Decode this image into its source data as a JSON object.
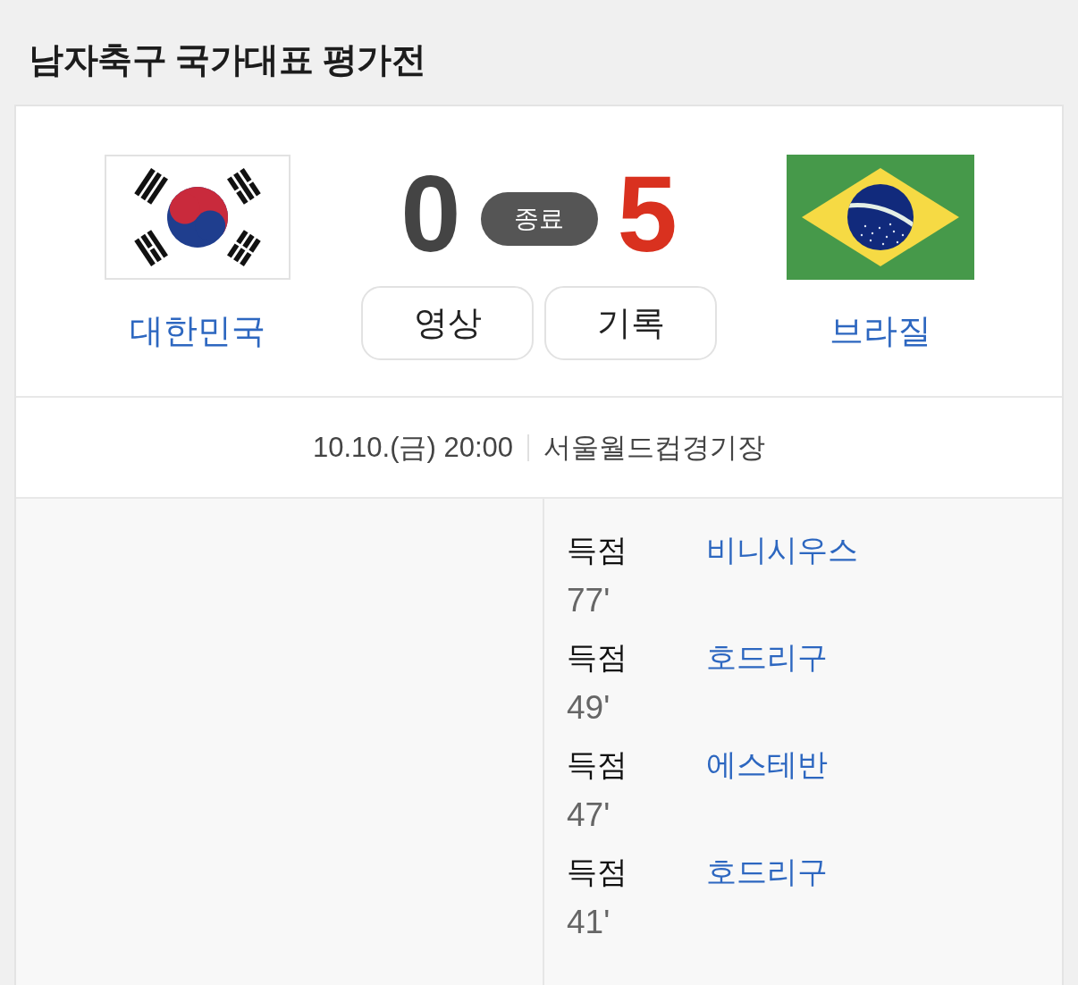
{
  "title": "남자축구 국가대표 평가전",
  "match": {
    "home": {
      "name": "대한민국",
      "score": "0",
      "winner": false
    },
    "away": {
      "name": "브라질",
      "score": "5",
      "winner": true
    },
    "status": "종료",
    "buttons": [
      "영상",
      "기록"
    ]
  },
  "info": {
    "datetime": "10.10.(금) 20:00",
    "venue": "서울월드컵경기장"
  },
  "away_goals": [
    {
      "label": "득점",
      "player": "비니시우스",
      "minute": "77'"
    },
    {
      "label": "득점",
      "player": "호드리구",
      "minute": "49'"
    },
    {
      "label": "득점",
      "player": "에스테반",
      "minute": "47'"
    },
    {
      "label": "득점",
      "player": "호드리구",
      "minute": "41'"
    }
  ]
}
